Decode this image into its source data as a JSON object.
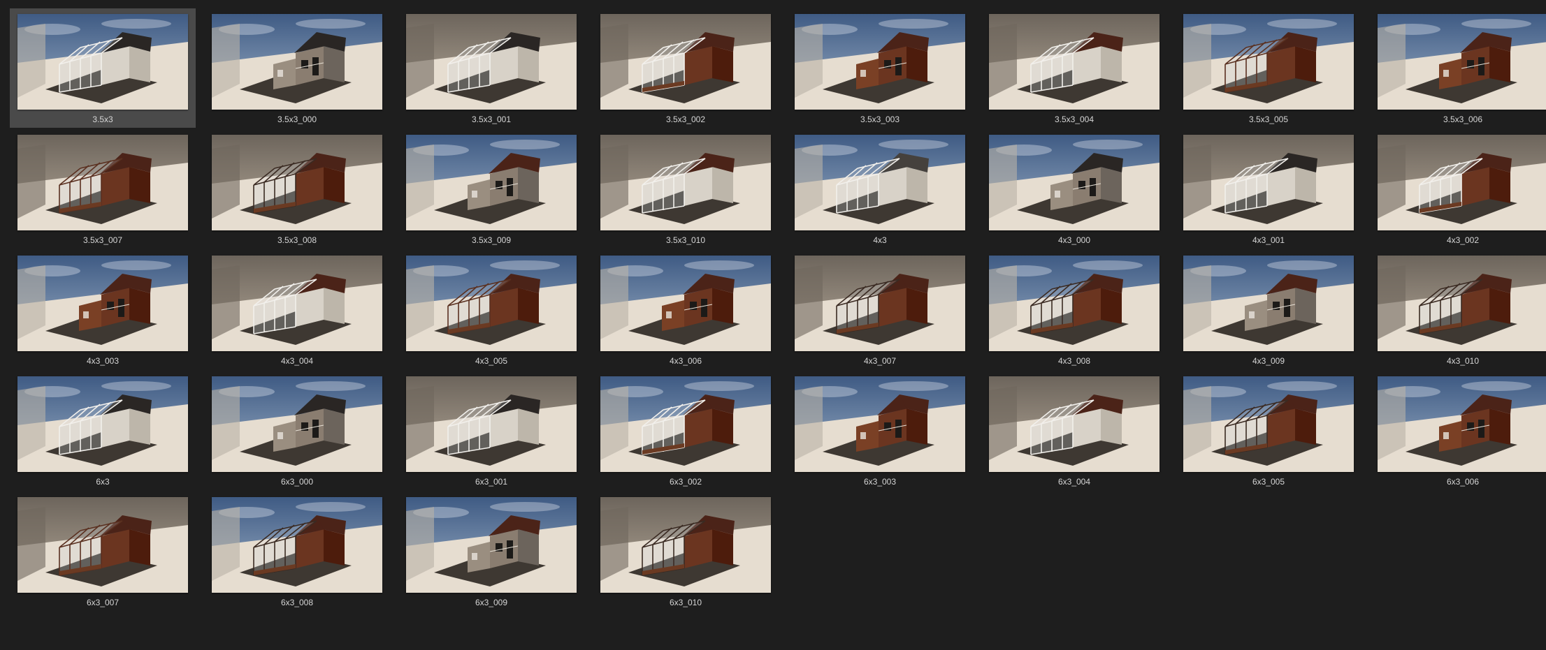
{
  "gallery": {
    "selected_index": 0,
    "items": [
      {
        "label": "3.5x3",
        "sky": true,
        "style": "glass",
        "roof": "dark"
      },
      {
        "label": "3.5x3_000",
        "sky": true,
        "style": "grey",
        "roof": "dark"
      },
      {
        "label": "3.5x3_001",
        "sky": false,
        "style": "glass",
        "roof": "dark"
      },
      {
        "label": "3.5x3_002",
        "sky": false,
        "style": "glass-brown",
        "roof": "brown"
      },
      {
        "label": "3.5x3_003",
        "sky": true,
        "style": "brown",
        "roof": "brown"
      },
      {
        "label": "3.5x3_004",
        "sky": false,
        "style": "glass",
        "roof": "brown"
      },
      {
        "label": "3.5x3_005",
        "sky": true,
        "style": "frame-brown",
        "roof": "brown"
      },
      {
        "label": "3.5x3_006",
        "sky": true,
        "style": "brown",
        "roof": "brown"
      },
      {
        "label": "3.5x3_007",
        "sky": false,
        "style": "frame-brown",
        "roof": "brown"
      },
      {
        "label": "3.5x3_008",
        "sky": false,
        "style": "frame-dark",
        "roof": "brown"
      },
      {
        "label": "3.5x3_009",
        "sky": true,
        "style": "grey",
        "roof": "brown"
      },
      {
        "label": "3.5x3_010",
        "sky": false,
        "style": "glass",
        "roof": "brown"
      },
      {
        "label": "4x3",
        "sky": true,
        "style": "glass",
        "roof": "grey"
      },
      {
        "label": "4x3_000",
        "sky": true,
        "style": "grey",
        "roof": "dark"
      },
      {
        "label": "4x3_001",
        "sky": false,
        "style": "glass",
        "roof": "dark"
      },
      {
        "label": "4x3_002",
        "sky": false,
        "style": "glass-brown",
        "roof": "brown"
      },
      {
        "label": "4x3_003",
        "sky": true,
        "style": "brown",
        "roof": "brown"
      },
      {
        "label": "4x3_004",
        "sky": false,
        "style": "glass",
        "roof": "brown"
      },
      {
        "label": "4x3_005",
        "sky": true,
        "style": "frame-brown",
        "roof": "brown"
      },
      {
        "label": "4x3_006",
        "sky": true,
        "style": "brown",
        "roof": "brown"
      },
      {
        "label": "4x3_007",
        "sky": false,
        "style": "frame-dark",
        "roof": "brown"
      },
      {
        "label": "4x3_008",
        "sky": true,
        "style": "frame-dark",
        "roof": "brown"
      },
      {
        "label": "4x3_009",
        "sky": true,
        "style": "grey",
        "roof": "brown"
      },
      {
        "label": "4x3_010",
        "sky": false,
        "style": "frame-dark",
        "roof": "brown"
      },
      {
        "label": "6x3",
        "sky": true,
        "style": "glass",
        "roof": "dark"
      },
      {
        "label": "6x3_000",
        "sky": true,
        "style": "grey",
        "roof": "dark"
      },
      {
        "label": "6x3_001",
        "sky": false,
        "style": "glass",
        "roof": "dark"
      },
      {
        "label": "6x3_002",
        "sky": true,
        "style": "glass-brown",
        "roof": "brown"
      },
      {
        "label": "6x3_003",
        "sky": true,
        "style": "brown",
        "roof": "brown"
      },
      {
        "label": "6x3_004",
        "sky": false,
        "style": "glass",
        "roof": "brown"
      },
      {
        "label": "6x3_005",
        "sky": true,
        "style": "frame-dark",
        "roof": "brown"
      },
      {
        "label": "6x3_006",
        "sky": true,
        "style": "brown",
        "roof": "brown"
      },
      {
        "label": "6x3_007",
        "sky": false,
        "style": "frame-brown",
        "roof": "brown"
      },
      {
        "label": "6x3_008",
        "sky": true,
        "style": "frame-dark",
        "roof": "brown"
      },
      {
        "label": "6x3_009",
        "sky": true,
        "style": "grey",
        "roof": "brown"
      },
      {
        "label": "6x3_010",
        "sky": false,
        "style": "frame-dark",
        "roof": "brown"
      }
    ]
  },
  "colors": {
    "background": "#1e1e1e",
    "selected_bg": "#4a4a4a",
    "caption": "#d6d6d6",
    "sky_top": "#3f5b84",
    "sky_bottom": "#9fb2c8",
    "ground": "#e6ddd0",
    "wall_shadow": "#8d8578",
    "glass_frame": "#f2f0ec",
    "brown_wall": "#6b3520",
    "grey_wall": "#8a7d70",
    "dark_roof": "#2a2624",
    "brown_roof": "#4b2318",
    "shadow": "#2b2620"
  }
}
